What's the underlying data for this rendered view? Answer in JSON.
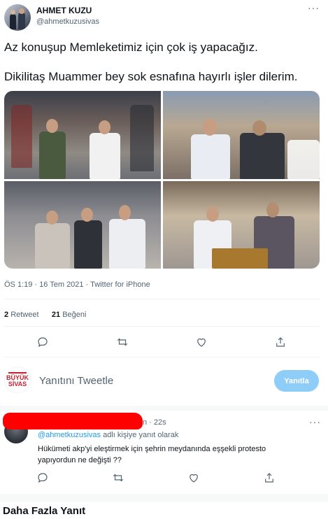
{
  "author": {
    "name": "AHMET KUZU",
    "handle": "@ahmetkuzusivas"
  },
  "tweet": {
    "line1": "Az konuşup Memleketimiz için çok iş yapacağız.",
    "line2": "Dikilitaş Muammer bey sok esnafına hayırlı işler dilerim.",
    "meta": "ÖS 1:19 · 16 Tem 2021 · Twitter for iPhone",
    "retweet_count": "2",
    "retweet_label": "Retweet",
    "like_count": "21",
    "like_label": "Beğeni"
  },
  "icons": [
    "more-icon",
    "reply-icon",
    "retweet-icon",
    "like-icon",
    "share-icon"
  ],
  "composer": {
    "avatar_line1": "BÜYÜK",
    "avatar_line2": "SİVAS",
    "placeholder": "Yanıtını Tweetle",
    "reply_button": "Yanıtla"
  },
  "reply": {
    "time": "n · 22s",
    "replying_mention": "@ahmetkuzusivas",
    "replying_suffix": " adlı kişiye yanıt olarak",
    "text": "Hükümeti akp'yi eleştirmek için şehrin meydanında eşşekli protesto yapıyordun ne değişti ??"
  },
  "more_replies_heading": "Daha Fazla Yanıt",
  "colors": {
    "accent": "#1d9bf0",
    "reply_button": "#8ecdf8",
    "redaction": "#ff0000",
    "muted_text": "#536471"
  }
}
